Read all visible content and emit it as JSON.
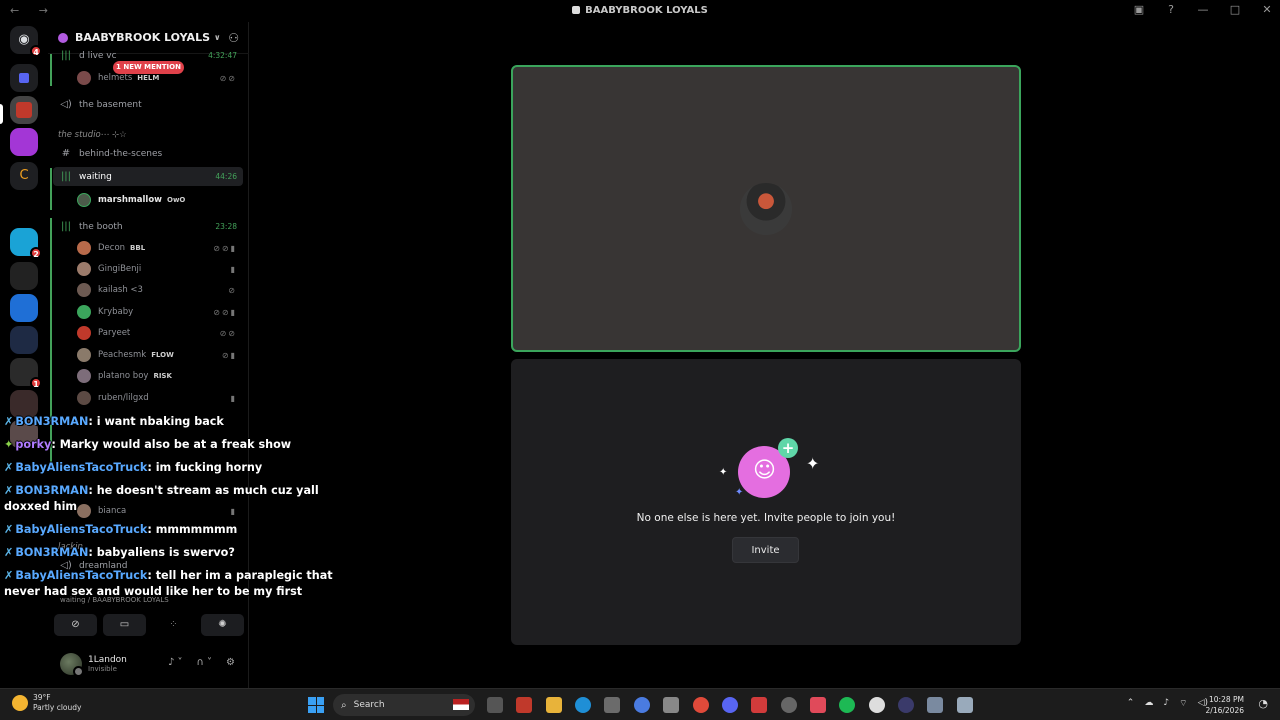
{
  "window": {
    "title": "BAABYBROOK LOYALS",
    "nav": "← →"
  },
  "server": {
    "name": "BAABYBROOK LOYALS"
  },
  "channels": {
    "mention_pill": "1 NEW MENTION",
    "top_partial": "d live vc",
    "top_partial_time": "4:32:47",
    "basement": "the basement",
    "category_studio": "the studio⋯ ⊹☆",
    "behind_scenes": "behind-the-scenes",
    "waiting": "waiting",
    "waiting_time": "44:26",
    "booth": "the booth",
    "booth_time": "23:28",
    "dreamland": "dreamland",
    "category_lackin": "lackin",
    "voice_location": "waiting / BAABYBROOK LOYALS"
  },
  "members_waiting": [
    {
      "name": "marshmallow",
      "tag": "OwO",
      "color": "#4c5a4a"
    }
  ],
  "members_top": [
    {
      "name": "helmets",
      "tag": "HELM",
      "color": "#7a4a4a"
    }
  ],
  "members_booth": [
    {
      "name": "Decon",
      "tag": "BBL",
      "color": "#b86a4a",
      "icons": "⊘⊘▮"
    },
    {
      "name": "GingiBenji",
      "tag": "",
      "color": "#9c7b6b",
      "icons": "▮"
    },
    {
      "name": "kailash <3",
      "tag": "",
      "color": "#6d5a52",
      "icons": "⊘"
    },
    {
      "name": "Krybaby",
      "tag": "",
      "color": "#3ba55c",
      "icons": "⊘⊘▮"
    },
    {
      "name": "Paryeet",
      "tag": "",
      "color": "#c0392b",
      "icons": "⊘⊘"
    },
    {
      "name": "Peachesmk",
      "tag": "FLOW",
      "color": "#8a7a6a",
      "icons": "⊘▮"
    },
    {
      "name": "platano boy",
      "tag": "RISK",
      "color": "#7d6d7a",
      "icons": ""
    },
    {
      "name": "ruben/lilgxd",
      "tag": "",
      "color": "#5c4a44",
      "icons": "▮"
    },
    {
      "name": "bianca",
      "tag": "",
      "color": "#8a6f60",
      "icons": "▮"
    }
  ],
  "user": {
    "name": "1Landon",
    "status": "Invisible"
  },
  "chat": [
    {
      "badge": "✗",
      "author": "BON3RMAN",
      "text": "i want nbaking back"
    },
    {
      "badge": "✦",
      "author": "porky",
      "text": "Marky would also be at a freak show"
    },
    {
      "badge": "✗",
      "author": "BabyAliensTacoTruck",
      "text": "im fucking horny"
    },
    {
      "badge": "✗",
      "author": "BON3RMAN",
      "text": "he doesn't stream as much cuz yall doxxed him"
    },
    {
      "badge": "✗",
      "author": "BabyAliensTacoTruck",
      "text": "mmmmmmm"
    },
    {
      "badge": "✗",
      "author": "BON3RMAN",
      "text": "babyaliens is swervo?"
    },
    {
      "badge": "✗",
      "author": "BabyAliensTacoTruck",
      "text": "tell her im a paraplegic that never had sex and would like her to be my first"
    }
  ],
  "stage": {
    "empty_text": "No one else is here yet. Invite people to join you!",
    "invite_label": "Invite"
  },
  "taskbar": {
    "temp": "39°F",
    "weather": "Partly cloudy",
    "search_placeholder": "Search",
    "time": "10:28 PM",
    "date": "2/16/2026"
  },
  "colors": {
    "speaking_border": "#3ba55c",
    "mention": "#e0414a",
    "accent_pink": "#e46ee0"
  }
}
